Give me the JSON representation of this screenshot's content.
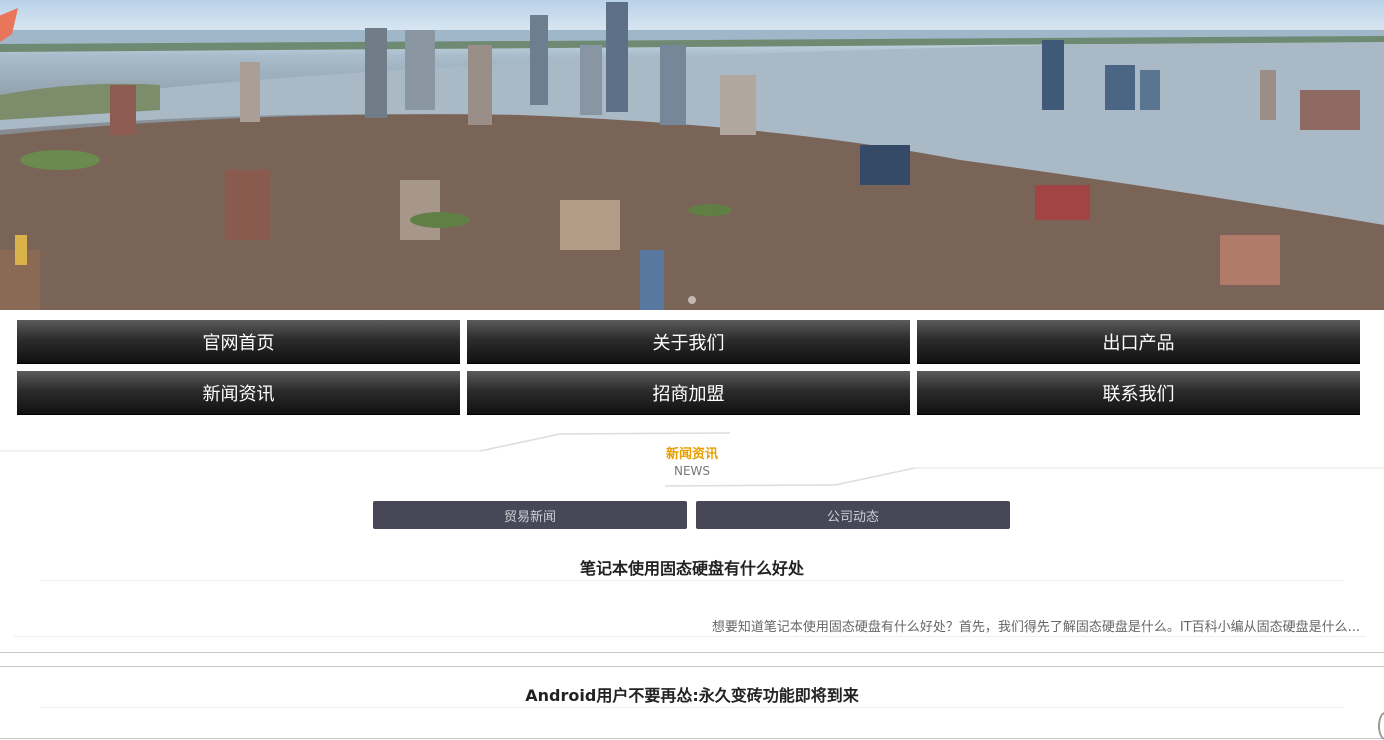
{
  "nav": {
    "items": [
      {
        "label": "官网首页"
      },
      {
        "label": "关于我们"
      },
      {
        "label": "出口产品"
      },
      {
        "label": "新闻资讯"
      },
      {
        "label": "招商加盟"
      },
      {
        "label": "联系我们"
      }
    ]
  },
  "section": {
    "title": "新闻资讯",
    "subtitle": "NEWS"
  },
  "tabs": [
    {
      "label": "贸易新闻"
    },
    {
      "label": "公司动态"
    }
  ],
  "news": [
    {
      "title": "笔记本使用固态硬盘有什么好处",
      "excerpt": "想要知道笔记本使用固态硬盘有什么好处？首先，我们得先了解固态硬盘是什么。IT百科小编从固态硬盘是什么..."
    },
    {
      "title": "Android用户不要再怂:永久变砖功能即将到来"
    }
  ],
  "colors": {
    "nav_bg": "#1a1a1a",
    "tab_bg": "#474757",
    "accent": "#e8a000"
  }
}
